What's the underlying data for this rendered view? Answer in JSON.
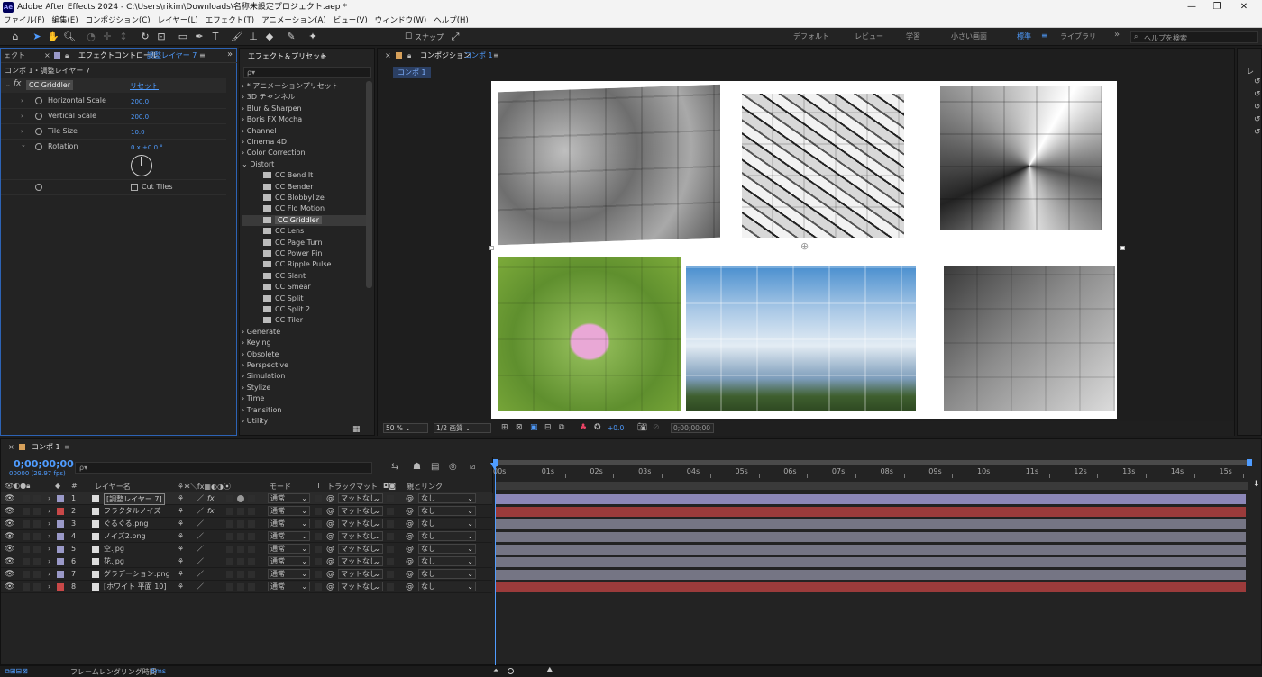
{
  "app": {
    "title": "Adobe After Effects 2024 - C:\\Users\\rikim\\Downloads\\名称未設定プロジェクト.aep *",
    "logo": "Ae"
  },
  "menu": [
    "ファイル(F)",
    "編集(E)",
    "コンポジション(C)",
    "レイヤー(L)",
    "エフェクト(T)",
    "アニメーション(A)",
    "ビュー(V)",
    "ウィンドウ(W)",
    "ヘルプ(H)"
  ],
  "toolbar": {
    "snap_label": "スナップ",
    "workspaces": [
      "デフォルト",
      "レビュー",
      "学習",
      "小さい画面",
      "標準",
      "ライブラリ"
    ],
    "active_workspace": "標準",
    "help_search_placeholder": "ヘルプを検索"
  },
  "effect_controls": {
    "tab_left": "ェクト",
    "tab_prefix": "エフェクトコントロール",
    "tab_layer": "調整レイヤー 7",
    "layer_path": "コンポ 1・調整レイヤー 7",
    "effect_name": "CC Griddler",
    "reset_label": "リセット",
    "props": [
      {
        "name": "Horizontal Scale",
        "value": "200.0"
      },
      {
        "name": "Vertical Scale",
        "value": "200.0"
      },
      {
        "name": "Tile Size",
        "value": "10.0"
      },
      {
        "name": "Rotation",
        "value": "0 x +0.0 °"
      }
    ],
    "cut_tiles_label": "Cut Tiles"
  },
  "effects_presets": {
    "title": "エフェクト＆プリセット",
    "search_placeholder": "ρ▾",
    "categories_top": [
      "* アニメーションプリセット",
      "3D チャンネル",
      "Blur & Sharpen",
      "Boris FX Mocha",
      "Channel",
      "Cinema 4D",
      "Color Correction",
      "Distort"
    ],
    "distort_items": [
      "CC Bend It",
      "CC Bender",
      "CC Blobbylize",
      "CC Flo Motion",
      "CC Griddler",
      "CC Lens",
      "CC Page Turn",
      "CC Power Pin",
      "CC Ripple Pulse",
      "CC Slant",
      "CC Smear",
      "CC Split",
      "CC Split 2",
      "CC Tiler"
    ],
    "selected": "CC Griddler",
    "categories_bottom": [
      "Generate",
      "Keying",
      "Obsolete",
      "Perspective",
      "Simulation",
      "Stylize",
      "Time",
      "Transition",
      "Utility"
    ]
  },
  "composition": {
    "panel_title": "コンポジション",
    "comp_name": "コンポ 1",
    "tab_label": "コンポ 1",
    "zoom": "50 %",
    "resolution": "1/2 画質",
    "exposure": "+0.0",
    "timecode": "0;00;00;00"
  },
  "timeline": {
    "tab_label": "コンポ 1",
    "timecode": "0;00;00;00",
    "fps": "00000 (29.97 fps)",
    "search_placeholder": "ρ▾",
    "col_layer_name": "レイヤー名",
    "col_mode": "モード",
    "col_t": "T",
    "col_trackmatte": "トラックマット",
    "col_parent": "親とリンク",
    "ruler": [
      "00s",
      "01s",
      "02s",
      "03s",
      "04s",
      "05s",
      "06s",
      "07s",
      "08s",
      "09s",
      "10s",
      "11s",
      "12s",
      "13s",
      "14s",
      "15s"
    ],
    "layers": [
      {
        "num": "1",
        "name": "[調整レイヤー 7]",
        "label": "#9a99c8",
        "mode": "通常",
        "matte": "マットなし",
        "parent": "なし",
        "bar": "#8c87b8",
        "fx": true
      },
      {
        "num": "2",
        "name": "フラクタルノイズ",
        "label": "#c84848",
        "mode": "通常",
        "matte": "マットなし",
        "parent": "なし",
        "bar": "#9b3b3b",
        "fx": true
      },
      {
        "num": "3",
        "name": "ぐるぐる.png",
        "label": "#9a99c8",
        "mode": "通常",
        "matte": "マットなし",
        "parent": "なし",
        "bar": "#757584",
        "fx": false
      },
      {
        "num": "4",
        "name": "ノイズ2.png",
        "label": "#9a99c8",
        "mode": "通常",
        "matte": "マットなし",
        "parent": "なし",
        "bar": "#757584",
        "fx": false
      },
      {
        "num": "5",
        "name": "空.jpg",
        "label": "#9a99c8",
        "mode": "通常",
        "matte": "マットなし",
        "parent": "なし",
        "bar": "#757584",
        "fx": false
      },
      {
        "num": "6",
        "name": "花.jpg",
        "label": "#9a99c8",
        "mode": "通常",
        "matte": "マットなし",
        "parent": "なし",
        "bar": "#757584",
        "fx": false
      },
      {
        "num": "7",
        "name": "グラデーション.png",
        "label": "#9a99c8",
        "mode": "通常",
        "matte": "マットなし",
        "parent": "なし",
        "bar": "#757584",
        "fx": false
      },
      {
        "num": "8",
        "name": "[ホワイト 平面 10]",
        "label": "#c84848",
        "mode": "通常",
        "matte": "マットなし",
        "parent": "なし",
        "bar": "#9b3b3b",
        "fx": false
      }
    ]
  },
  "status": {
    "render_label": "フレームレンダリング時間",
    "render_time": "6ms"
  }
}
